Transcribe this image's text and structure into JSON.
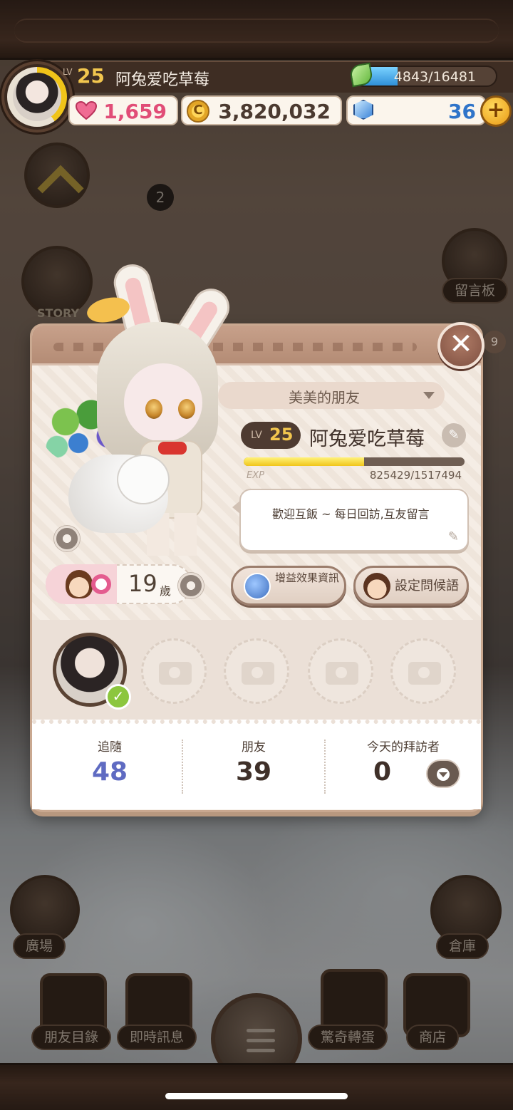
{
  "player": {
    "level_label": "LV",
    "level": "25",
    "name": "阿兔爱吃草莓",
    "exp_display": "4843/16481"
  },
  "resources": {
    "hearts": "1,659",
    "coin_symbol": "C",
    "coins": "3,820,032",
    "gems": "36",
    "add_symbol": "+"
  },
  "hud": {
    "up_badge": "2",
    "story_label": "STORY",
    "memo_board_label": "留言板",
    "right_badge": "9",
    "plaza_label": "廣場",
    "storage_label": "倉庫",
    "friends_list_label": "朋友目錄",
    "messages_label": "即時訊息",
    "gacha_label": "驚奇轉蛋",
    "shop_label": "商店"
  },
  "profile": {
    "close_symbol": "✕",
    "title": "美美的朋友",
    "level_label": "LV",
    "level": "25",
    "name": "阿兔爱吃草莓",
    "edit_symbol": "✎",
    "exp_label": "EXP",
    "exp_current": 825429,
    "exp_max": 1517494,
    "exp_text": "825429/1517494",
    "greeting": "歡迎互飯 ~ 每日回訪,互友留言",
    "age": "19",
    "age_unit": "歲",
    "buff_button": "增益效果資訊",
    "greeting_button": "設定問候語",
    "check_symbol": "✓"
  },
  "stats": {
    "follow_label": "追隨",
    "follow_value": "48",
    "friends_label": "朋友",
    "friends_value": "39",
    "visitors_label": "今天的拜訪者",
    "visitors_value": "0"
  }
}
